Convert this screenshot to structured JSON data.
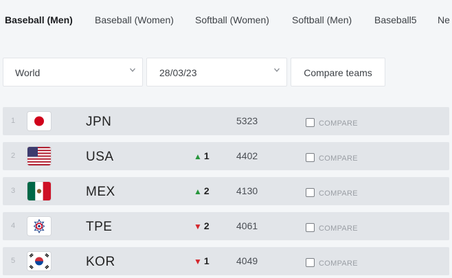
{
  "tabs": [
    {
      "label": "Baseball (Men)",
      "active": true
    },
    {
      "label": "Baseball (Women)",
      "active": false
    },
    {
      "label": "Softball (Women)",
      "active": false
    },
    {
      "label": "Softball (Men)",
      "active": false
    },
    {
      "label": "Baseball5",
      "active": false
    },
    {
      "label": "Ne",
      "active": false
    }
  ],
  "filters": {
    "region": {
      "value": "World",
      "icon": "chevron-down-icon"
    },
    "date": {
      "value": "28/03/23",
      "icon": "chevron-down-icon"
    },
    "compare_button": "Compare teams"
  },
  "rankings": [
    {
      "rank": "1",
      "flag": "japan-flag-icon",
      "code": "JPN",
      "movement": "",
      "direction": "none",
      "points": "5323",
      "compare_label": "COMPARE"
    },
    {
      "rank": "2",
      "flag": "usa-flag-icon",
      "code": "USA",
      "movement": "1",
      "direction": "up",
      "points": "4402",
      "compare_label": "COMPARE"
    },
    {
      "rank": "3",
      "flag": "mexico-flag-icon",
      "code": "MEX",
      "movement": "2",
      "direction": "up",
      "points": "4130",
      "compare_label": "COMPARE"
    },
    {
      "rank": "4",
      "flag": "chinese-taipei-flag-icon",
      "code": "TPE",
      "movement": "2",
      "direction": "down",
      "points": "4061",
      "compare_label": "COMPARE"
    },
    {
      "rank": "5",
      "flag": "korea-flag-icon",
      "code": "KOR",
      "movement": "1",
      "direction": "down",
      "points": "4049",
      "compare_label": "COMPARE"
    }
  ],
  "colors": {
    "up": "#27963c",
    "down": "#d4262c",
    "row_bg": "#e2e5e9",
    "page_bg": "#f4f6f8"
  }
}
